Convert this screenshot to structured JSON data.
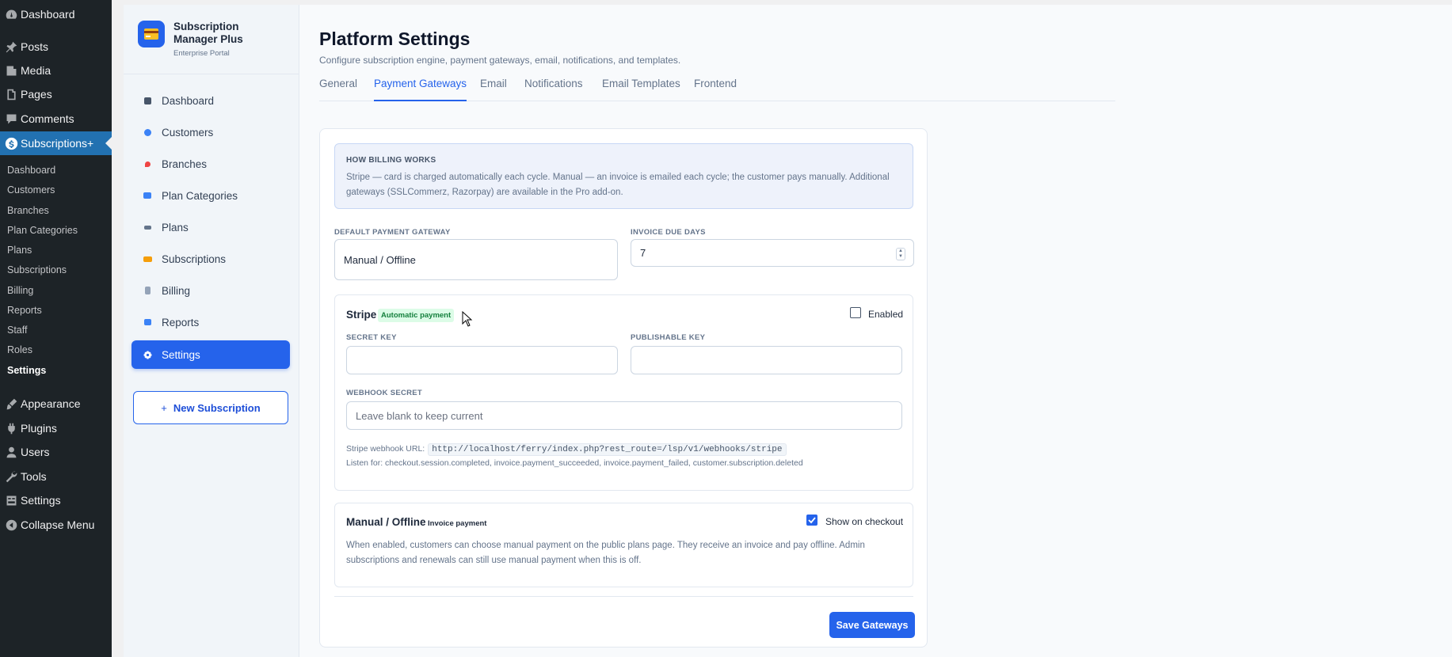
{
  "wp_menu": {
    "items": [
      {
        "label": "Dashboard",
        "icon": "dashboard-icon"
      },
      {
        "label": "Posts",
        "icon": "pin-icon"
      },
      {
        "label": "Media",
        "icon": "media-icon"
      },
      {
        "label": "Pages",
        "icon": "pages-icon"
      },
      {
        "label": "Comments",
        "icon": "comments-icon"
      },
      {
        "label": "Subscriptions+",
        "icon": "dollar-icon"
      }
    ],
    "submenu": [
      "Dashboard",
      "Customers",
      "Branches",
      "Plan Categories",
      "Plans",
      "Subscriptions",
      "Billing",
      "Reports",
      "Staff",
      "Roles",
      "Settings"
    ],
    "bottom_items": [
      {
        "label": "Appearance",
        "icon": "brush-icon"
      },
      {
        "label": "Plugins",
        "icon": "plugins-icon"
      },
      {
        "label": "Users",
        "icon": "users-icon"
      },
      {
        "label": "Tools",
        "icon": "wrench-icon"
      },
      {
        "label": "Settings",
        "icon": "settings-icon"
      },
      {
        "label": "Collapse Menu",
        "icon": "collapse-icon"
      }
    ]
  },
  "brand": {
    "title": "Subscription Manager Plus",
    "subtitle": "Enterprise Portal",
    "logo_icon": "card-icon"
  },
  "nav": {
    "items": [
      {
        "label": "Dashboard",
        "icon": "dashboard-icon",
        "color": "#475569"
      },
      {
        "label": "Customers",
        "icon": "customers-icon",
        "color": "#3b82f6"
      },
      {
        "label": "Branches",
        "icon": "location-pin-icon",
        "color": "#ef4444"
      },
      {
        "label": "Plan Categories",
        "icon": "folder-icon",
        "color": "#3b82f6"
      },
      {
        "label": "Plans",
        "icon": "tag-icon",
        "color": "#64748b"
      },
      {
        "label": "Subscriptions",
        "icon": "credit-card-icon",
        "color": "#f59e0b"
      },
      {
        "label": "Billing",
        "icon": "receipt-icon",
        "color": "#94a3b8"
      },
      {
        "label": "Reports",
        "icon": "bar-chart-icon",
        "color": "#3b82f6"
      },
      {
        "label": "Settings",
        "icon": "gear-icon",
        "color": "#ffffff"
      }
    ],
    "new_button": "New Subscription"
  },
  "page": {
    "title": "Platform Settings",
    "description": "Configure subscription engine, payment gateways, email, notifications, and templates.",
    "tabs": [
      "General",
      "Payment Gateways",
      "Email",
      "Notifications",
      "Email Templates",
      "Frontend"
    ]
  },
  "info": {
    "title": "HOW BILLING WORKS",
    "text": "Stripe — card is charged automatically each cycle. Manual — an invoice is emailed each cycle; the customer pays manually. Additional gateways (SSLCommerz, Razorpay) are available in the Pro add-on."
  },
  "fields": {
    "default_gateway_label": "DEFAULT PAYMENT GATEWAY",
    "default_gateway_value": "Manual / Offline",
    "invoice_due_label": "INVOICE DUE DAYS",
    "invoice_due_value": "7"
  },
  "stripe": {
    "title": "Stripe",
    "badge": "Automatic payment",
    "enabled_label": "Enabled",
    "enabled": false,
    "secret_key_label": "SECRET KEY",
    "publishable_key_label": "PUBLISHABLE KEY",
    "webhook_secret_label": "WEBHOOK SECRET",
    "webhook_secret_placeholder": "Leave blank to keep current",
    "webhook_url_label": "Stripe webhook URL:",
    "webhook_url": "http://localhost/ferry/index.php?rest_route=/lsp/v1/webhooks/stripe",
    "listen_for": "Listen for: checkout.session.completed, invoice.payment_succeeded, invoice.payment_failed, customer.subscription.deleted"
  },
  "manual": {
    "title": "Manual / Offline",
    "badge": "Invoice payment",
    "checkout_label": "Show on checkout",
    "checkout": true,
    "description": "When enabled, customers can choose manual payment on the public plans page. They receive an invoice and pay offline. Admin subscriptions and renewals can still use manual payment when this is off."
  },
  "save_button": "Save Gateways",
  "colors": {
    "accent": "#2563eb",
    "wp_sidebar": "#1d2327",
    "wp_active": "#2271b1"
  }
}
